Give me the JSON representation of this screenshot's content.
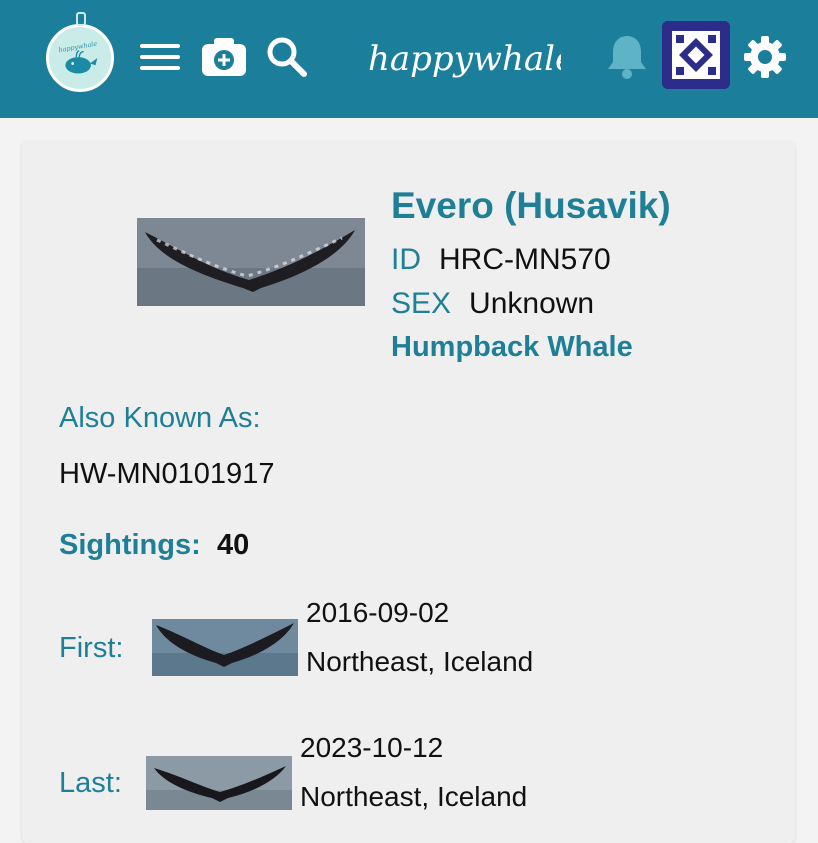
{
  "header": {
    "brand": "happywhale",
    "logo_text": "happywhale",
    "icons": [
      "whale-logo-icon",
      "menu-icon",
      "camera-icon",
      "search-icon",
      "bell-icon",
      "avatar",
      "gear-icon"
    ],
    "colors": {
      "bar": "#1b7f9b",
      "accent": "#1f7f97"
    }
  },
  "individual": {
    "name": "Evero (Husavik)",
    "id_label": "ID",
    "id_value": "HRC-MN570",
    "sex_label": "SEX",
    "sex_value": "Unknown",
    "species": "Humpback Whale",
    "aka_label": "Also Known As:",
    "aka_value": "HW-MN0101917",
    "sightings_label": "Sightings:",
    "sightings_value": "40",
    "first": {
      "label": "First:",
      "date": "2016-09-02",
      "location": "Northeast, Iceland"
    },
    "last": {
      "label": "Last:",
      "date": "2023-10-12",
      "location": "Northeast, Iceland"
    }
  }
}
